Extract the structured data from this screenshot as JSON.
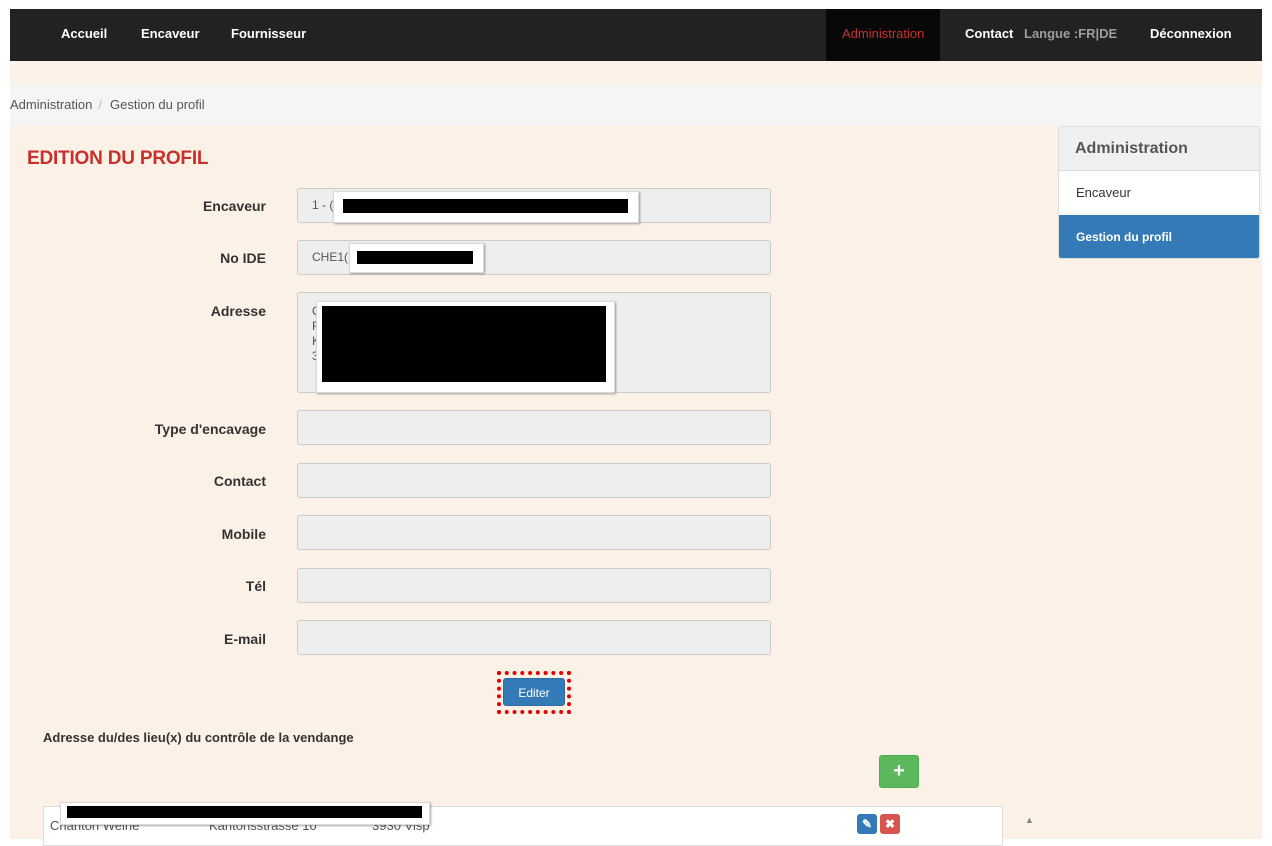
{
  "nav": {
    "accueil": "Accueil",
    "encaveur": "Encaveur",
    "fournisseur": "Fournisseur",
    "administration": "Administration",
    "contact": "Contact",
    "langue": "Langue :FR|DE",
    "deconnexion": "Déconnexion"
  },
  "breadcrumb": {
    "parent": "Administration",
    "separator": "/",
    "current": "Gestion du profil"
  },
  "page_title": "EDITION DU PROFIL",
  "form": {
    "encaveur": {
      "label": "Encaveur",
      "value": "1 - ("
    },
    "no_ide": {
      "label": "No IDE",
      "value": "CHE1("
    },
    "adresse": {
      "label": "Adresse",
      "lines": [
        "O",
        "R",
        "K",
        "3!"
      ]
    },
    "type_encavage": {
      "label": "Type d'encavage",
      "value": ""
    },
    "contact": {
      "label": "Contact",
      "value": ""
    },
    "mobile": {
      "label": "Mobile",
      "value": ""
    },
    "tel": {
      "label": "Tél",
      "value": ""
    },
    "email": {
      "label": "E-mail",
      "value": ""
    }
  },
  "edit_button": "Editer",
  "section_title": "Adresse du/des lieu(x) du contrôle de la vendange",
  "add_button": "+",
  "table": {
    "rows": [
      {
        "name": "Chanton Weine",
        "street": "Kantonsstrasse 10",
        "city": "3930 Visp"
      }
    ],
    "edit_icon": "✎",
    "delete_icon": "✖"
  },
  "sidebar": {
    "title": "Administration",
    "items": [
      {
        "label": "Encaveur",
        "active": false
      },
      {
        "label": "Gestion du profil",
        "active": true
      }
    ]
  },
  "colors": {
    "accent": "#c9302c",
    "primary": "#337ab7",
    "success": "#5cb85c",
    "navbar": "#222222",
    "page_bg": "#fbf1e6"
  }
}
